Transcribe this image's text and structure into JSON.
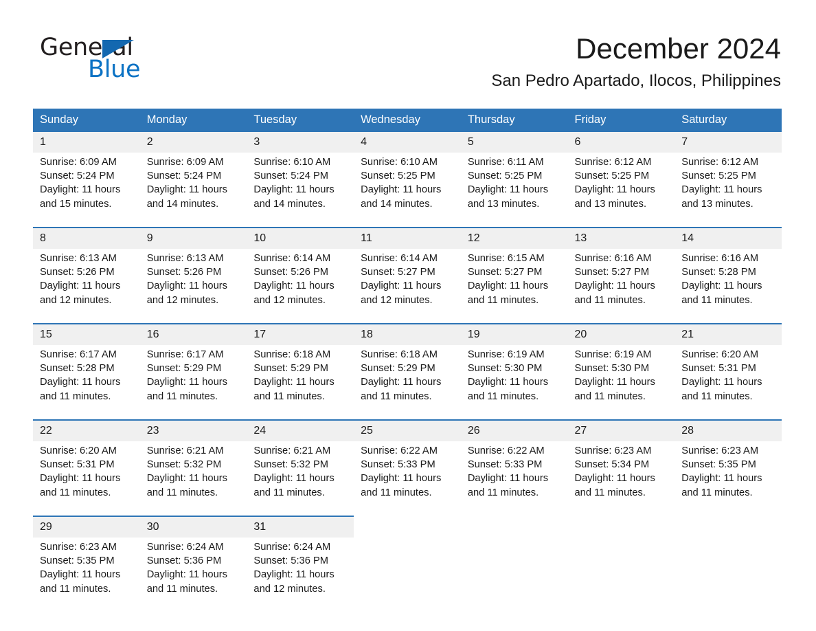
{
  "brand": {
    "name_part1": "General",
    "name_part2": "Blue",
    "logo_icon": "triangle-icon",
    "accent_color": "#1368b0",
    "blue_text_color": "#0b72c4"
  },
  "header": {
    "title": "December 2024",
    "subtitle": "San Pedro Apartado, Ilocos, Philippines"
  },
  "theme": {
    "header_bg": "#2e75b6",
    "header_text": "#ffffff",
    "daynum_bg": "#f0f0f0",
    "separator": "#2e75b6",
    "body_text": "#1a1a1a"
  },
  "calendar": {
    "weekday_headers": [
      "Sunday",
      "Monday",
      "Tuesday",
      "Wednesday",
      "Thursday",
      "Friday",
      "Saturday"
    ],
    "weeks": [
      {
        "days": [
          {
            "date": "1",
            "sunrise": "Sunrise: 6:09 AM",
            "sunset": "Sunset: 5:24 PM",
            "daylight": "Daylight: 11 hours and 15 minutes."
          },
          {
            "date": "2",
            "sunrise": "Sunrise: 6:09 AM",
            "sunset": "Sunset: 5:24 PM",
            "daylight": "Daylight: 11 hours and 14 minutes."
          },
          {
            "date": "3",
            "sunrise": "Sunrise: 6:10 AM",
            "sunset": "Sunset: 5:24 PM",
            "daylight": "Daylight: 11 hours and 14 minutes."
          },
          {
            "date": "4",
            "sunrise": "Sunrise: 6:10 AM",
            "sunset": "Sunset: 5:25 PM",
            "daylight": "Daylight: 11 hours and 14 minutes."
          },
          {
            "date": "5",
            "sunrise": "Sunrise: 6:11 AM",
            "sunset": "Sunset: 5:25 PM",
            "daylight": "Daylight: 11 hours and 13 minutes."
          },
          {
            "date": "6",
            "sunrise": "Sunrise: 6:12 AM",
            "sunset": "Sunset: 5:25 PM",
            "daylight": "Daylight: 11 hours and 13 minutes."
          },
          {
            "date": "7",
            "sunrise": "Sunrise: 6:12 AM",
            "sunset": "Sunset: 5:25 PM",
            "daylight": "Daylight: 11 hours and 13 minutes."
          }
        ]
      },
      {
        "days": [
          {
            "date": "8",
            "sunrise": "Sunrise: 6:13 AM",
            "sunset": "Sunset: 5:26 PM",
            "daylight": "Daylight: 11 hours and 12 minutes."
          },
          {
            "date": "9",
            "sunrise": "Sunrise: 6:13 AM",
            "sunset": "Sunset: 5:26 PM",
            "daylight": "Daylight: 11 hours and 12 minutes."
          },
          {
            "date": "10",
            "sunrise": "Sunrise: 6:14 AM",
            "sunset": "Sunset: 5:26 PM",
            "daylight": "Daylight: 11 hours and 12 minutes."
          },
          {
            "date": "11",
            "sunrise": "Sunrise: 6:14 AM",
            "sunset": "Sunset: 5:27 PM",
            "daylight": "Daylight: 11 hours and 12 minutes."
          },
          {
            "date": "12",
            "sunrise": "Sunrise: 6:15 AM",
            "sunset": "Sunset: 5:27 PM",
            "daylight": "Daylight: 11 hours and 11 minutes."
          },
          {
            "date": "13",
            "sunrise": "Sunrise: 6:16 AM",
            "sunset": "Sunset: 5:27 PM",
            "daylight": "Daylight: 11 hours and 11 minutes."
          },
          {
            "date": "14",
            "sunrise": "Sunrise: 6:16 AM",
            "sunset": "Sunset: 5:28 PM",
            "daylight": "Daylight: 11 hours and 11 minutes."
          }
        ]
      },
      {
        "days": [
          {
            "date": "15",
            "sunrise": "Sunrise: 6:17 AM",
            "sunset": "Sunset: 5:28 PM",
            "daylight": "Daylight: 11 hours and 11 minutes."
          },
          {
            "date": "16",
            "sunrise": "Sunrise: 6:17 AM",
            "sunset": "Sunset: 5:29 PM",
            "daylight": "Daylight: 11 hours and 11 minutes."
          },
          {
            "date": "17",
            "sunrise": "Sunrise: 6:18 AM",
            "sunset": "Sunset: 5:29 PM",
            "daylight": "Daylight: 11 hours and 11 minutes."
          },
          {
            "date": "18",
            "sunrise": "Sunrise: 6:18 AM",
            "sunset": "Sunset: 5:29 PM",
            "daylight": "Daylight: 11 hours and 11 minutes."
          },
          {
            "date": "19",
            "sunrise": "Sunrise: 6:19 AM",
            "sunset": "Sunset: 5:30 PM",
            "daylight": "Daylight: 11 hours and 11 minutes."
          },
          {
            "date": "20",
            "sunrise": "Sunrise: 6:19 AM",
            "sunset": "Sunset: 5:30 PM",
            "daylight": "Daylight: 11 hours and 11 minutes."
          },
          {
            "date": "21",
            "sunrise": "Sunrise: 6:20 AM",
            "sunset": "Sunset: 5:31 PM",
            "daylight": "Daylight: 11 hours and 11 minutes."
          }
        ]
      },
      {
        "days": [
          {
            "date": "22",
            "sunrise": "Sunrise: 6:20 AM",
            "sunset": "Sunset: 5:31 PM",
            "daylight": "Daylight: 11 hours and 11 minutes."
          },
          {
            "date": "23",
            "sunrise": "Sunrise: 6:21 AM",
            "sunset": "Sunset: 5:32 PM",
            "daylight": "Daylight: 11 hours and 11 minutes."
          },
          {
            "date": "24",
            "sunrise": "Sunrise: 6:21 AM",
            "sunset": "Sunset: 5:32 PM",
            "daylight": "Daylight: 11 hours and 11 minutes."
          },
          {
            "date": "25",
            "sunrise": "Sunrise: 6:22 AM",
            "sunset": "Sunset: 5:33 PM",
            "daylight": "Daylight: 11 hours and 11 minutes."
          },
          {
            "date": "26",
            "sunrise": "Sunrise: 6:22 AM",
            "sunset": "Sunset: 5:33 PM",
            "daylight": "Daylight: 11 hours and 11 minutes."
          },
          {
            "date": "27",
            "sunrise": "Sunrise: 6:23 AM",
            "sunset": "Sunset: 5:34 PM",
            "daylight": "Daylight: 11 hours and 11 minutes."
          },
          {
            "date": "28",
            "sunrise": "Sunrise: 6:23 AM",
            "sunset": "Sunset: 5:35 PM",
            "daylight": "Daylight: 11 hours and 11 minutes."
          }
        ]
      },
      {
        "days": [
          {
            "date": "29",
            "sunrise": "Sunrise: 6:23 AM",
            "sunset": "Sunset: 5:35 PM",
            "daylight": "Daylight: 11 hours and 11 minutes."
          },
          {
            "date": "30",
            "sunrise": "Sunrise: 6:24 AM",
            "sunset": "Sunset: 5:36 PM",
            "daylight": "Daylight: 11 hours and 11 minutes."
          },
          {
            "date": "31",
            "sunrise": "Sunrise: 6:24 AM",
            "sunset": "Sunset: 5:36 PM",
            "daylight": "Daylight: 11 hours and 12 minutes."
          },
          {
            "date": "",
            "sunrise": "",
            "sunset": "",
            "daylight": ""
          },
          {
            "date": "",
            "sunrise": "",
            "sunset": "",
            "daylight": ""
          },
          {
            "date": "",
            "sunrise": "",
            "sunset": "",
            "daylight": ""
          },
          {
            "date": "",
            "sunrise": "",
            "sunset": "",
            "daylight": ""
          }
        ]
      }
    ]
  }
}
